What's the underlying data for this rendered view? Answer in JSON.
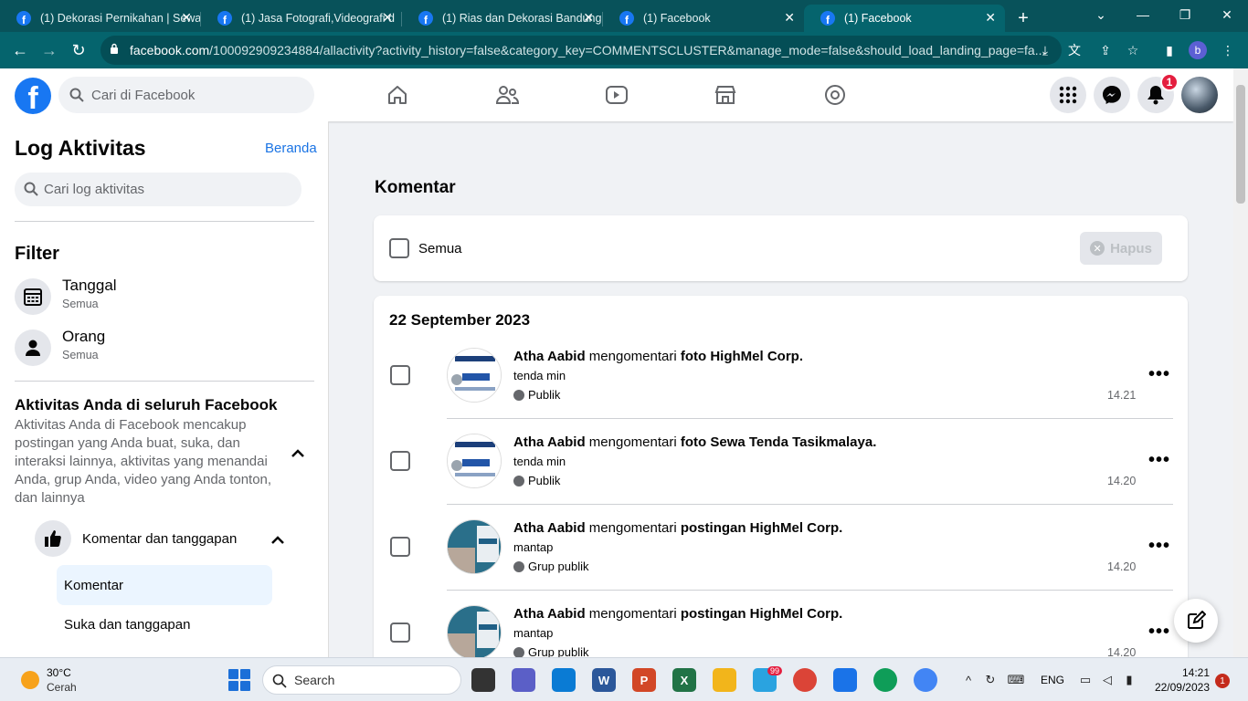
{
  "browser": {
    "tabs": [
      {
        "title": "(1) Dekorasi Pernikahan | Sewa"
      },
      {
        "title": "(1) Jasa Fotografi,Videografi d"
      },
      {
        "title": "(1) Rias dan Dekorasi Bandung"
      },
      {
        "title": "(1) Facebook"
      },
      {
        "title": "(1) Facebook"
      }
    ],
    "new_tab": "+",
    "url_host": "facebook.com",
    "url_path": "/100092909234884/allactivity?activity_history=false&category_key=COMMENTSCLUSTER&manage_mode=false&should_load_landing_page=fa...",
    "profile_letter": "b"
  },
  "fb": {
    "search_placeholder": "Cari di Facebook",
    "notification_count": "1"
  },
  "sidebar": {
    "title": "Log Aktivitas",
    "home_link": "Beranda",
    "search_placeholder": "Cari log aktivitas",
    "filter_title": "Filter",
    "filters": [
      {
        "label": "Tanggal",
        "value": "Semua"
      },
      {
        "label": "Orang",
        "value": "Semua"
      }
    ],
    "activity_title": "Aktivitas Anda di seluruh Facebook",
    "activity_desc": "Aktivitas Anda di Facebook mencakup postingan yang Anda buat, suka, dan interaksi lainnya, aktivitas yang menandai Anda, grup Anda, video yang Anda tonton, dan lainnya",
    "category": "Komentar dan tanggapan",
    "sub_items": [
      "Komentar",
      "Suka dan tanggapan"
    ]
  },
  "main": {
    "title": "Komentar",
    "select_all": "Semua",
    "delete_button": "Hapus",
    "date_heading": "22 September 2023",
    "entries": [
      {
        "actor": "Atha Aabid",
        "verb": "mengomentari",
        "object": "foto HighMel Corp.",
        "comment": "tenda min",
        "audience": "Publik",
        "time": "14.21",
        "more": "•••"
      },
      {
        "actor": "Atha Aabid",
        "verb": "mengomentari",
        "object": "foto Sewa Tenda Tasikmalaya.",
        "comment": "tenda min",
        "audience": "Publik",
        "time": "14.20",
        "more": "•••"
      },
      {
        "actor": "Atha Aabid",
        "verb": "mengomentari",
        "object": "postingan HighMel Corp.",
        "comment": "mantap",
        "audience": "Grup publik",
        "time": "14.20",
        "more": "•••"
      },
      {
        "actor": "Atha Aabid",
        "verb": "mengomentari",
        "object": "postingan HighMel Corp.",
        "comment": "mantap",
        "audience": "Grup publik",
        "time": "14.20",
        "more": "•••"
      }
    ]
  },
  "taskbar": {
    "temperature": "30°C",
    "condition": "Cerah",
    "search": "Search",
    "language": "ENG",
    "time": "14:21",
    "date": "22/09/2023",
    "notifications": "1",
    "telegram_badge": "99"
  },
  "colors": {
    "fb_blue": "#1877f2",
    "chrome_dark": "#08525a",
    "link": "#1b74e4"
  }
}
